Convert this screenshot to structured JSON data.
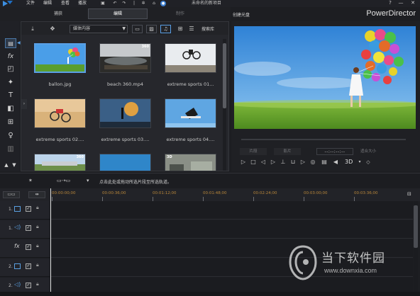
{
  "titlebar": {
    "menus": [
      "文件",
      "编辑",
      "查看",
      "播放"
    ],
    "document_title": "未命名的新项目",
    "help": "?",
    "minimize": "—",
    "close": "✕"
  },
  "modes": {
    "capture": "捕获",
    "edit": "编辑",
    "produce": "制作",
    "create_disc": "创建光盘",
    "brand": "PowerDirector"
  },
  "library": {
    "media_select": "媒体内容",
    "search": "搜索库",
    "clips": [
      {
        "label": "ballon.jpg",
        "badge": ""
      },
      {
        "label": "beach 360.mp4",
        "badge": "360"
      },
      {
        "label": "extreme sports 01...",
        "badge": ""
      },
      {
        "label": "extreme sports 02....",
        "badge": ""
      },
      {
        "label": "extreme sports 03....",
        "badge": ""
      },
      {
        "label": "extreme sports 04....",
        "badge": ""
      },
      {
        "label": "",
        "badge": "360"
      },
      {
        "label": "",
        "badge": ""
      },
      {
        "label": "",
        "badge": "3D"
      }
    ]
  },
  "preview": {
    "clip_btn": "片段",
    "movie_btn": "影片",
    "timecode": "--:--:--:--",
    "zoom": "适合大小",
    "btn_3d": "3D"
  },
  "hint": {
    "text": "点击此处或拖动所选片段至所选轨道。"
  },
  "timeline": {
    "ticks": [
      "00:00:00;00",
      "00:00:36;00",
      "00:01:12;00",
      "00:01:48;00",
      "00:02:24;00",
      "00:03:00;00",
      "00:03:36;00"
    ],
    "tracks": [
      {
        "num": "1.",
        "type": "video"
      },
      {
        "num": "1.",
        "type": "audio"
      },
      {
        "num": "",
        "type": "fx"
      },
      {
        "num": "2.",
        "type": "video"
      },
      {
        "num": "2.",
        "type": "audio"
      }
    ]
  },
  "watermark": {
    "title": "当下软件园",
    "url": "www.downxia.com"
  }
}
